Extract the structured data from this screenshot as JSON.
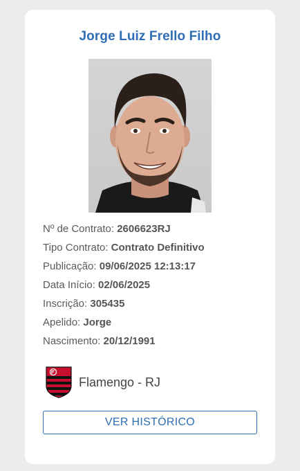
{
  "player": {
    "name": "Jorge Luiz Frello Filho",
    "photo_icon": "player-photo"
  },
  "details": [
    {
      "label": "Nº de Contrato:",
      "value": "2606623RJ"
    },
    {
      "label": "Tipo Contrato:",
      "value": "Contrato Definitivo"
    },
    {
      "label": "Publicação:",
      "value": "09/06/2025 12:13:17"
    },
    {
      "label": "Data Início:",
      "value": "02/06/2025"
    },
    {
      "label": "Inscrição:",
      "value": "305435"
    },
    {
      "label": "Apelido:",
      "value": "Jorge"
    },
    {
      "label": "Nascimento:",
      "value": "20/12/1991"
    }
  ],
  "club": {
    "name": "Flamengo - RJ",
    "logo_icon": "flamengo-crest-icon",
    "colors": {
      "red": "#c8102e",
      "black": "#111111"
    }
  },
  "actions": {
    "history_label": "VER HISTÓRICO"
  },
  "theme": {
    "accent": "#2f6db4",
    "card_bg": "#ffffff",
    "page_bg": "#ececec"
  }
}
